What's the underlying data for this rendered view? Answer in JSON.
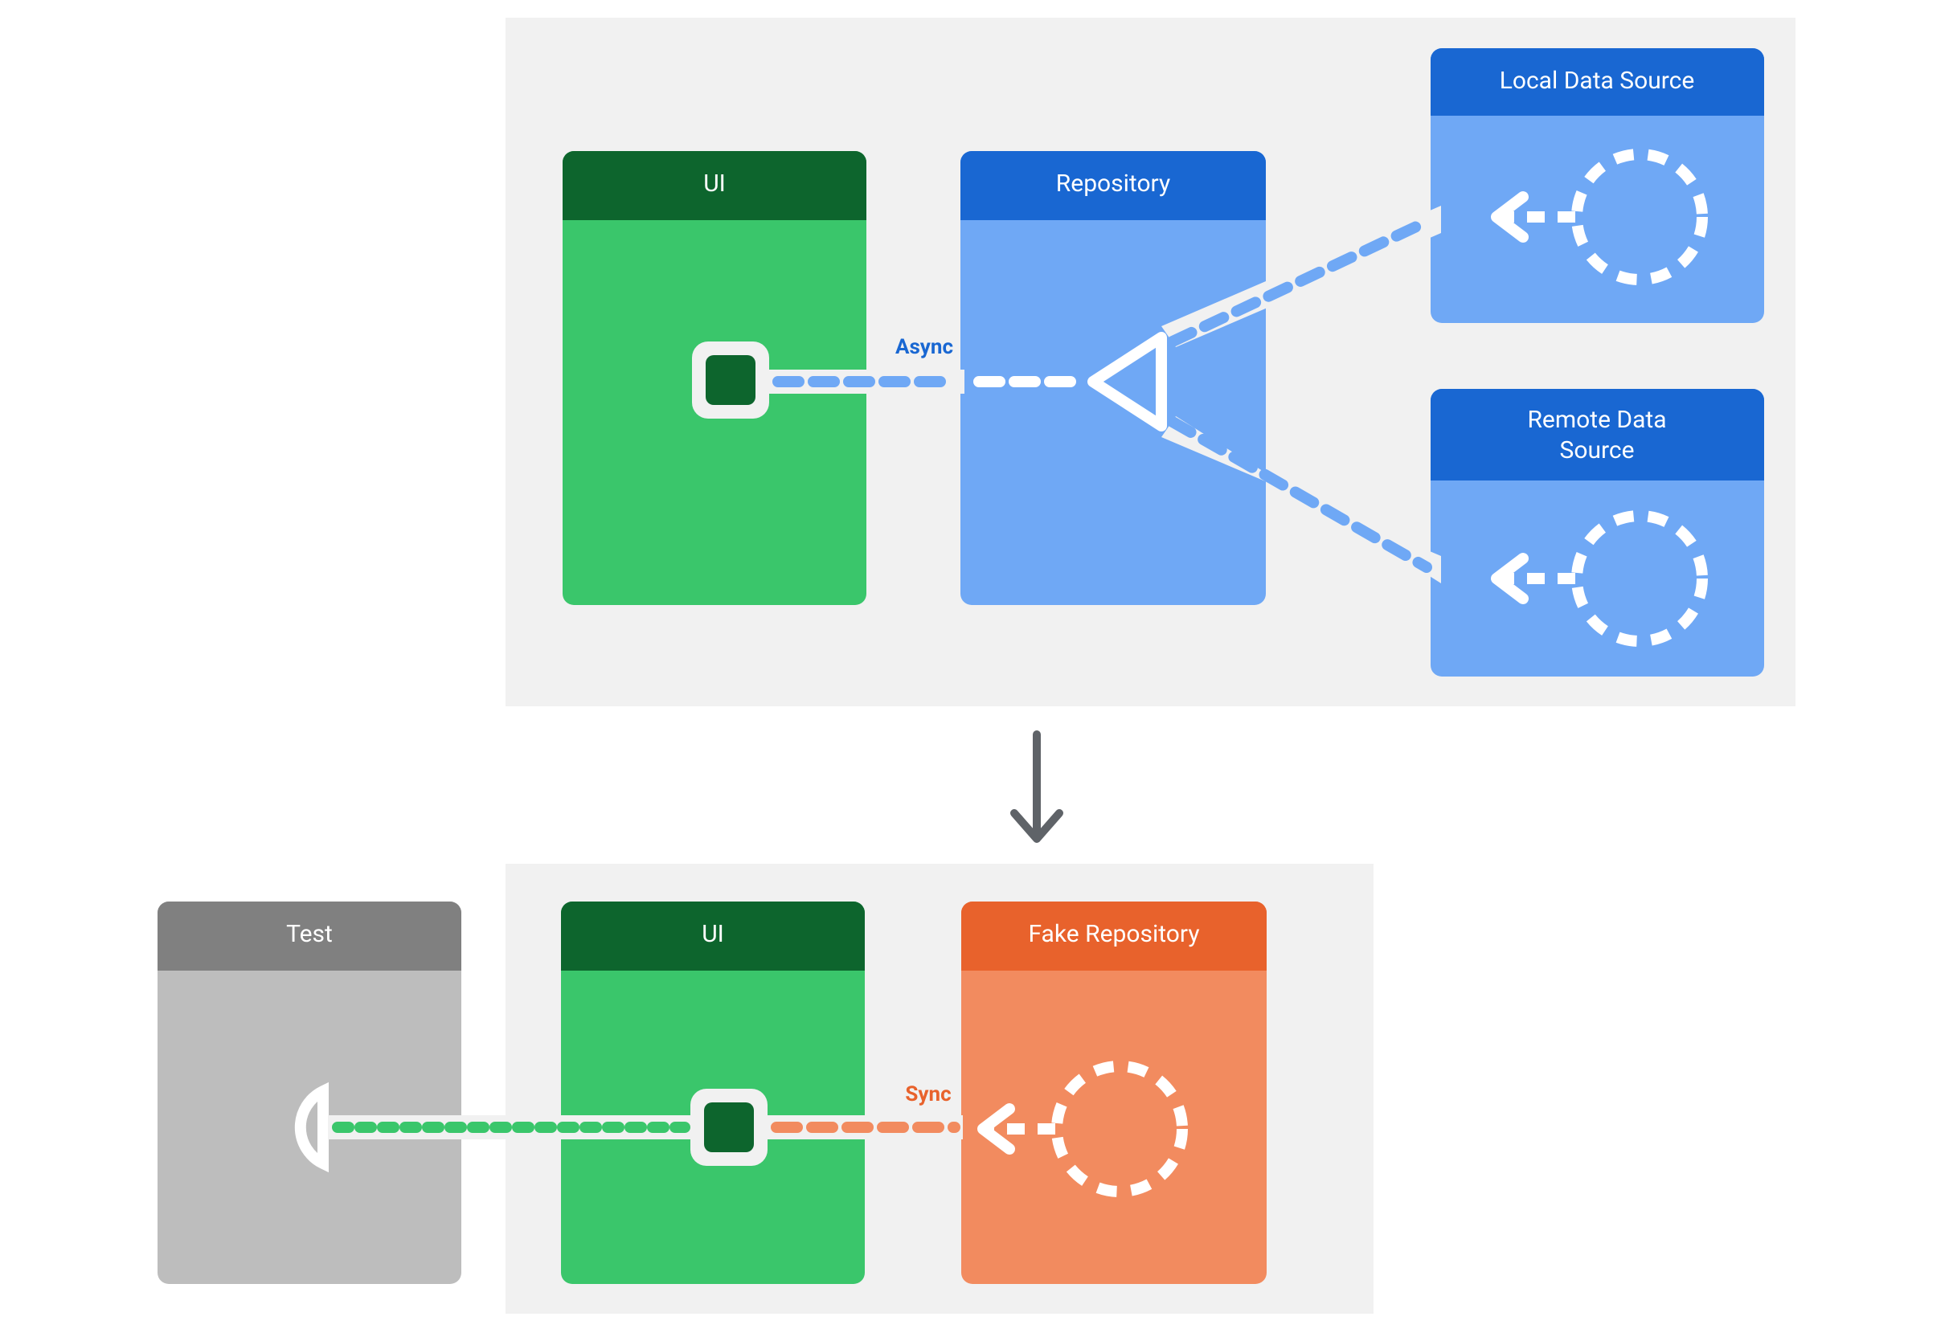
{
  "diagram": {
    "top": {
      "ui": "UI",
      "repo": "Repository",
      "local": "Local Data Source",
      "remote_line1": "Remote Data",
      "remote_line2": "Source",
      "edge_label": "Async"
    },
    "bottom": {
      "test": "Test",
      "ui": "UI",
      "fake": "Fake Repository",
      "edge_label": "Sync"
    },
    "colors": {
      "panel_bg": "#f1f1f1",
      "green_header": "#0d652d",
      "green_body": "#34c759",
      "green_body2": "#3ac66b",
      "blue_header": "#1967d2",
      "blue_body": "#6fa8f5",
      "orange_header": "#e8622c",
      "orange_body": "#f28b5f",
      "gray_header": "#808080",
      "gray_body": "#bdbdbd",
      "white": "#ffffff",
      "arrow_gray": "#5f6368",
      "async_text": "#1967d2",
      "sync_text": "#e8622c"
    }
  }
}
